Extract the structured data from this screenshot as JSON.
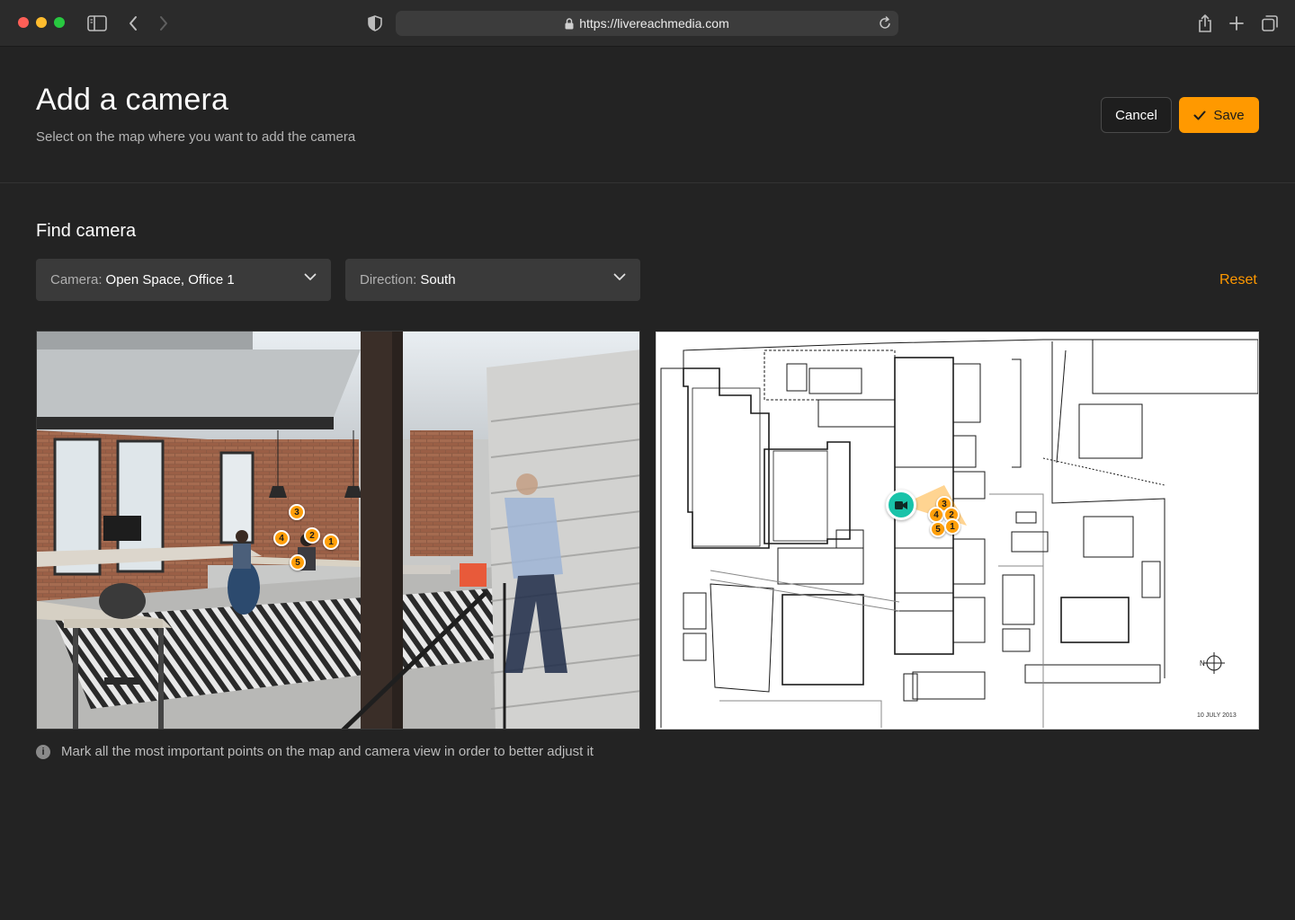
{
  "browser": {
    "url": "https://livereachmedia.com"
  },
  "header": {
    "title": "Add a camera",
    "subtitle": "Select on the map where you want to add the camera",
    "cancel_label": "Cancel",
    "save_label": "Save"
  },
  "find_camera": {
    "title": "Find camera",
    "camera_select": {
      "label": "Camera:",
      "value": "Open Space, Office 1"
    },
    "direction_select": {
      "label": "Direction:",
      "value": "South"
    },
    "reset_label": "Reset"
  },
  "photo_markers": [
    "3",
    "2",
    "4",
    "1",
    "5"
  ],
  "map_markers": [
    "3",
    "4",
    "2",
    "5",
    "1"
  ],
  "map_date": "10 JULY 2013",
  "compass_label": "N",
  "info_text": "Mark all the most important points on the map and camera view in order to better adjust it",
  "colors": {
    "accent": "#ff9900",
    "camera_pin": "#19c3a9",
    "background": "#232323"
  }
}
